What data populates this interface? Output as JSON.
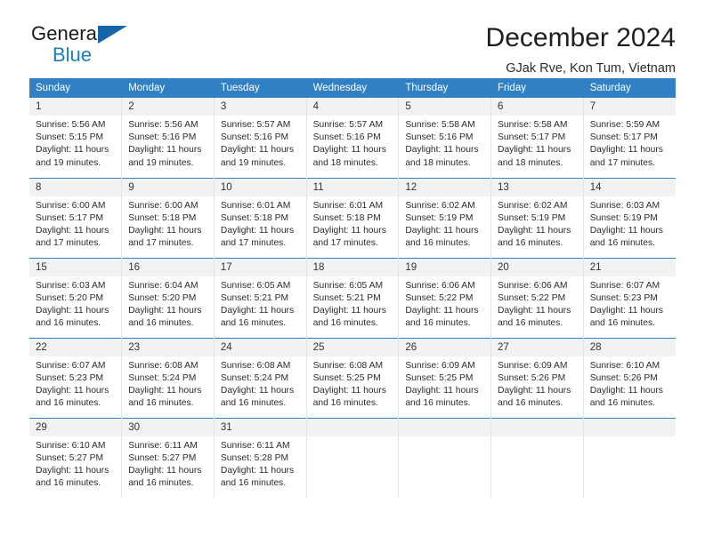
{
  "brand": {
    "name_top": "General",
    "name_bottom": "Blue",
    "triangle_color": "#1565a8",
    "blue": "#1e7bc4"
  },
  "header": {
    "title": "December 2024",
    "subtitle": "GJak Rve, Kon Tum, Vietnam"
  },
  "theme": {
    "header_bg": "#3180c4",
    "header_text": "#ffffff",
    "daynum_bg": "#f2f2f2",
    "cell_bg": "#ffffff",
    "row_divider": "#3180c4",
    "col_divider": "#e2e2e2"
  },
  "calendar": {
    "weekday_headers": [
      "Sunday",
      "Monday",
      "Tuesday",
      "Wednesday",
      "Thursday",
      "Friday",
      "Saturday"
    ],
    "labels": {
      "sunrise": "Sunrise:",
      "sunset": "Sunset:",
      "daylight": "Daylight:"
    },
    "weeks": [
      [
        {
          "day": "1",
          "sunrise": "Sunrise: 5:56 AM",
          "sunset": "Sunset: 5:15 PM",
          "daylight": "Daylight: 11 hours and 19 minutes."
        },
        {
          "day": "2",
          "sunrise": "Sunrise: 5:56 AM",
          "sunset": "Sunset: 5:16 PM",
          "daylight": "Daylight: 11 hours and 19 minutes."
        },
        {
          "day": "3",
          "sunrise": "Sunrise: 5:57 AM",
          "sunset": "Sunset: 5:16 PM",
          "daylight": "Daylight: 11 hours and 19 minutes."
        },
        {
          "day": "4",
          "sunrise": "Sunrise: 5:57 AM",
          "sunset": "Sunset: 5:16 PM",
          "daylight": "Daylight: 11 hours and 18 minutes."
        },
        {
          "day": "5",
          "sunrise": "Sunrise: 5:58 AM",
          "sunset": "Sunset: 5:16 PM",
          "daylight": "Daylight: 11 hours and 18 minutes."
        },
        {
          "day": "6",
          "sunrise": "Sunrise: 5:58 AM",
          "sunset": "Sunset: 5:17 PM",
          "daylight": "Daylight: 11 hours and 18 minutes."
        },
        {
          "day": "7",
          "sunrise": "Sunrise: 5:59 AM",
          "sunset": "Sunset: 5:17 PM",
          "daylight": "Daylight: 11 hours and 17 minutes."
        }
      ],
      [
        {
          "day": "8",
          "sunrise": "Sunrise: 6:00 AM",
          "sunset": "Sunset: 5:17 PM",
          "daylight": "Daylight: 11 hours and 17 minutes."
        },
        {
          "day": "9",
          "sunrise": "Sunrise: 6:00 AM",
          "sunset": "Sunset: 5:18 PM",
          "daylight": "Daylight: 11 hours and 17 minutes."
        },
        {
          "day": "10",
          "sunrise": "Sunrise: 6:01 AM",
          "sunset": "Sunset: 5:18 PM",
          "daylight": "Daylight: 11 hours and 17 minutes."
        },
        {
          "day": "11",
          "sunrise": "Sunrise: 6:01 AM",
          "sunset": "Sunset: 5:18 PM",
          "daylight": "Daylight: 11 hours and 17 minutes."
        },
        {
          "day": "12",
          "sunrise": "Sunrise: 6:02 AM",
          "sunset": "Sunset: 5:19 PM",
          "daylight": "Daylight: 11 hours and 16 minutes."
        },
        {
          "day": "13",
          "sunrise": "Sunrise: 6:02 AM",
          "sunset": "Sunset: 5:19 PM",
          "daylight": "Daylight: 11 hours and 16 minutes."
        },
        {
          "day": "14",
          "sunrise": "Sunrise: 6:03 AM",
          "sunset": "Sunset: 5:19 PM",
          "daylight": "Daylight: 11 hours and 16 minutes."
        }
      ],
      [
        {
          "day": "15",
          "sunrise": "Sunrise: 6:03 AM",
          "sunset": "Sunset: 5:20 PM",
          "daylight": "Daylight: 11 hours and 16 minutes."
        },
        {
          "day": "16",
          "sunrise": "Sunrise: 6:04 AM",
          "sunset": "Sunset: 5:20 PM",
          "daylight": "Daylight: 11 hours and 16 minutes."
        },
        {
          "day": "17",
          "sunrise": "Sunrise: 6:05 AM",
          "sunset": "Sunset: 5:21 PM",
          "daylight": "Daylight: 11 hours and 16 minutes."
        },
        {
          "day": "18",
          "sunrise": "Sunrise: 6:05 AM",
          "sunset": "Sunset: 5:21 PM",
          "daylight": "Daylight: 11 hours and 16 minutes."
        },
        {
          "day": "19",
          "sunrise": "Sunrise: 6:06 AM",
          "sunset": "Sunset: 5:22 PM",
          "daylight": "Daylight: 11 hours and 16 minutes."
        },
        {
          "day": "20",
          "sunrise": "Sunrise: 6:06 AM",
          "sunset": "Sunset: 5:22 PM",
          "daylight": "Daylight: 11 hours and 16 minutes."
        },
        {
          "day": "21",
          "sunrise": "Sunrise: 6:07 AM",
          "sunset": "Sunset: 5:23 PM",
          "daylight": "Daylight: 11 hours and 16 minutes."
        }
      ],
      [
        {
          "day": "22",
          "sunrise": "Sunrise: 6:07 AM",
          "sunset": "Sunset: 5:23 PM",
          "daylight": "Daylight: 11 hours and 16 minutes."
        },
        {
          "day": "23",
          "sunrise": "Sunrise: 6:08 AM",
          "sunset": "Sunset: 5:24 PM",
          "daylight": "Daylight: 11 hours and 16 minutes."
        },
        {
          "day": "24",
          "sunrise": "Sunrise: 6:08 AM",
          "sunset": "Sunset: 5:24 PM",
          "daylight": "Daylight: 11 hours and 16 minutes."
        },
        {
          "day": "25",
          "sunrise": "Sunrise: 6:08 AM",
          "sunset": "Sunset: 5:25 PM",
          "daylight": "Daylight: 11 hours and 16 minutes."
        },
        {
          "day": "26",
          "sunrise": "Sunrise: 6:09 AM",
          "sunset": "Sunset: 5:25 PM",
          "daylight": "Daylight: 11 hours and 16 minutes."
        },
        {
          "day": "27",
          "sunrise": "Sunrise: 6:09 AM",
          "sunset": "Sunset: 5:26 PM",
          "daylight": "Daylight: 11 hours and 16 minutes."
        },
        {
          "day": "28",
          "sunrise": "Sunrise: 6:10 AM",
          "sunset": "Sunset: 5:26 PM",
          "daylight": "Daylight: 11 hours and 16 minutes."
        }
      ],
      [
        {
          "day": "29",
          "sunrise": "Sunrise: 6:10 AM",
          "sunset": "Sunset: 5:27 PM",
          "daylight": "Daylight: 11 hours and 16 minutes."
        },
        {
          "day": "30",
          "sunrise": "Sunrise: 6:11 AM",
          "sunset": "Sunset: 5:27 PM",
          "daylight": "Daylight: 11 hours and 16 minutes."
        },
        {
          "day": "31",
          "sunrise": "Sunrise: 6:11 AM",
          "sunset": "Sunset: 5:28 PM",
          "daylight": "Daylight: 11 hours and 16 minutes."
        },
        {
          "day": "",
          "sunrise": "",
          "sunset": "",
          "daylight": ""
        },
        {
          "day": "",
          "sunrise": "",
          "sunset": "",
          "daylight": ""
        },
        {
          "day": "",
          "sunrise": "",
          "sunset": "",
          "daylight": ""
        },
        {
          "day": "",
          "sunrise": "",
          "sunset": "",
          "daylight": ""
        }
      ]
    ]
  }
}
